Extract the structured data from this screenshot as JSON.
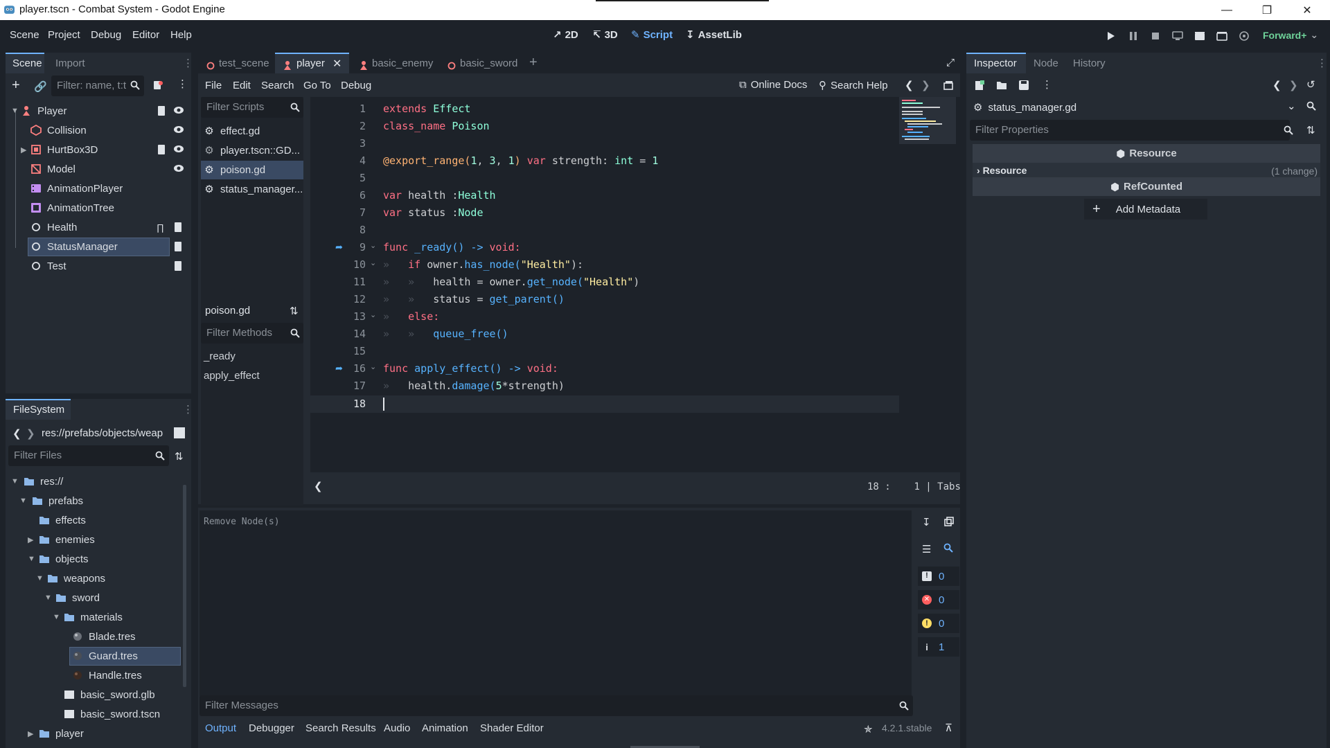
{
  "window": {
    "title": "player.tscn - Combat System - Godot Engine"
  },
  "menu": [
    "Scene",
    "Project",
    "Debug",
    "Editor",
    "Help"
  ],
  "workspaces": [
    {
      "label": "2D",
      "active": false
    },
    {
      "label": "3D",
      "active": false
    },
    {
      "label": "Script",
      "active": true
    },
    {
      "label": "AssetLib",
      "active": false
    }
  ],
  "renderer": "Forward+",
  "scene_dock": {
    "tabs": [
      "Scene",
      "Import"
    ],
    "filter_placeholder": "Filter: name, t:t",
    "nodes": [
      {
        "name": "Player",
        "icon": "character-icon"
      },
      {
        "name": "Collision",
        "icon": "collision-icon"
      },
      {
        "name": "HurtBox3D",
        "icon": "area-icon"
      },
      {
        "name": "Model",
        "icon": "model-icon"
      },
      {
        "name": "AnimationPlayer",
        "icon": "animation-player-icon"
      },
      {
        "name": "AnimationTree",
        "icon": "animation-tree-icon"
      },
      {
        "name": "Health",
        "icon": "node-icon"
      },
      {
        "name": "StatusManager",
        "icon": "node-icon"
      },
      {
        "name": "Test",
        "icon": "node-icon"
      }
    ]
  },
  "filesystem": {
    "tab": "FileSystem",
    "path": "res://prefabs/objects/weap",
    "filter_placeholder": "Filter Files",
    "items": [
      {
        "name": "res://",
        "type": "folder"
      },
      {
        "name": "prefabs",
        "type": "folder"
      },
      {
        "name": "effects",
        "type": "folder"
      },
      {
        "name": "enemies",
        "type": "folder"
      },
      {
        "name": "objects",
        "type": "folder"
      },
      {
        "name": "weapons",
        "type": "folder"
      },
      {
        "name": "sword",
        "type": "folder"
      },
      {
        "name": "materials",
        "type": "folder"
      },
      {
        "name": "Blade.tres",
        "type": "resource"
      },
      {
        "name": "Guard.tres",
        "type": "resource"
      },
      {
        "name": "Handle.tres",
        "type": "resource"
      },
      {
        "name": "basic_sword.glb",
        "type": "scene"
      },
      {
        "name": "basic_sword.tscn",
        "type": "scene"
      },
      {
        "name": "player",
        "type": "folder"
      }
    ]
  },
  "editor_tabs": [
    "test_scene",
    "player",
    "basic_enemy",
    "basic_sword"
  ],
  "script_menu": [
    "File",
    "Edit",
    "Search",
    "Go To",
    "Debug"
  ],
  "script_toolbar": {
    "online_docs": "Online Docs",
    "search_help": "Search Help"
  },
  "script_list": {
    "filter_placeholder": "Filter Scripts",
    "scripts": [
      "effect.gd",
      "player.tscn::GD...",
      "poison.gd",
      "status_manager..."
    ],
    "current": "poison.gd",
    "methods_placeholder": "Filter Methods",
    "methods": [
      "_ready",
      "apply_effect"
    ]
  },
  "code_lines": [
    "1",
    "2",
    "3",
    "4",
    "5",
    "6",
    "7",
    "8",
    "9",
    "10",
    "11",
    "12",
    "13",
    "14",
    "15",
    "16",
    "17",
    "18"
  ],
  "code": {
    "l1a": "extends",
    "l1b": "Effect",
    "l2a": "class_name",
    "l2b": "Poison",
    "l4a": "@export_range(",
    "l4b": "1",
    "l4c": "3",
    "l4d": "1",
    "l4e": "var",
    "l4f": "strength:",
    "l4g": "int",
    "l4h": "1",
    "l6a": "var",
    "l6b": "health :",
    "l6c": "Health",
    "l7a": "var",
    "l7b": "status :",
    "l7c": "Node",
    "l9a": "func",
    "l9b": "_ready() ->",
    "l9c": "void:",
    "l10a": "if",
    "l10b": "owner.",
    "l10c": "has_node(",
    "l10d": "\"Health\"",
    "l10e": "):",
    "l11a": "health = owner.",
    "l11b": "get_node(",
    "l11c": "\"Health\"",
    "l11d": ")",
    "l12a": "status = ",
    "l12b": "get_parent()",
    "l13a": "else:",
    "l14a": "queue_free()",
    "l16a": "func",
    "l16b": "apply_effect() ->",
    "l16c": "void:",
    "l17a": "health.",
    "l17b": "damage(",
    "l17c": "5",
    "l17d": "*strength)"
  },
  "status": {
    "line": "18",
    "col": "1",
    "indent": "Tabs"
  },
  "output": {
    "message": "Remove Node(s)",
    "filter_placeholder": "Filter Messages",
    "counts": [
      "0",
      "0",
      "0",
      "1"
    ],
    "tabs": [
      "Output",
      "Debugger",
      "Search Results",
      "Audio",
      "Animation",
      "Shader Editor"
    ],
    "version": "4.2.1.stable"
  },
  "inspector": {
    "tabs": [
      "Inspector",
      "Node",
      "History"
    ],
    "resource_name": "status_manager.gd",
    "filter_placeholder": "Filter Properties",
    "section_resource": "Resource",
    "group_resource": "Resource",
    "group_change": "(1 change)",
    "section_refcounted": "RefCounted",
    "add_metadata": "Add Metadata"
  },
  "colors": {
    "accent": "#6fb3ff",
    "background": "#1d2229",
    "panel": "#252b33",
    "keyword": "#ff7085",
    "class": "#8effda"
  }
}
